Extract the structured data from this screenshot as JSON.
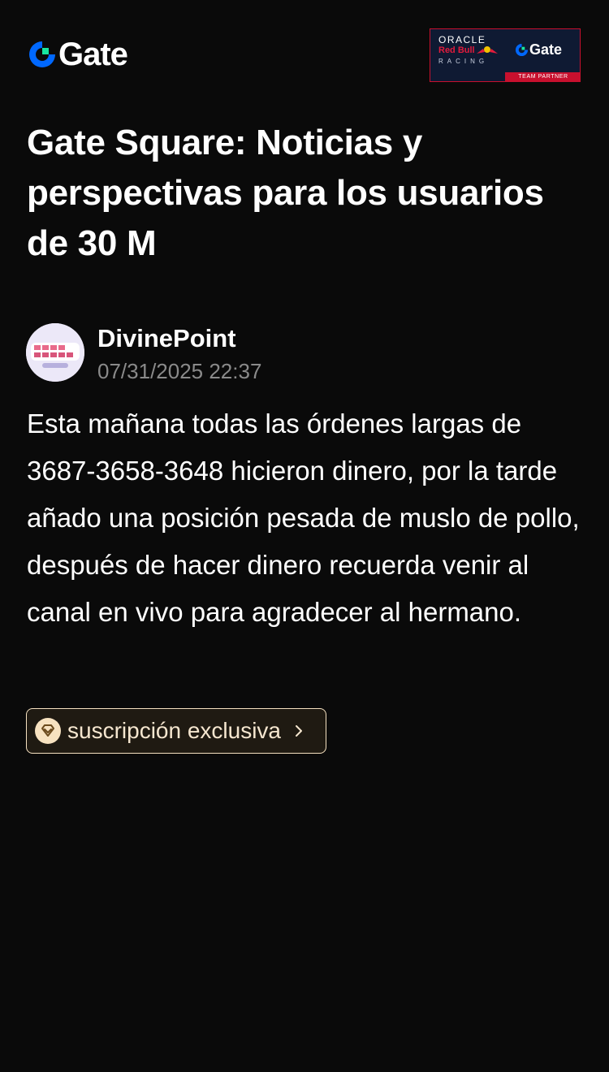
{
  "header": {
    "logo_text": "Gate",
    "badge": {
      "oracle": "ORACLE",
      "redbull": "Red Bull",
      "racing": "RACING",
      "gate": "Gate",
      "strip": "TEAM PARTNER"
    }
  },
  "article": {
    "title": "Gate Square: Noticias y perspectivas para los usuarios de 30 M",
    "author": {
      "name": "DivinePoint",
      "timestamp": "07/31/2025 22:37",
      "avatar_icon": "avatar-image"
    },
    "body": "Esta mañana todas las órdenes largas de 3687-3658-3648 hicieron dinero, por la tarde añado una posición pesada de muslo de pollo, después de hacer dinero recuerda venir al canal en vivo para agradecer al hermano.",
    "subscribe": {
      "label": "suscripción exclusiva",
      "icon": "diamond-icon",
      "chevron": "chevron-right-icon"
    }
  },
  "colors": {
    "background": "#0a0a0a",
    "brand_blue": "#0068ff",
    "brand_green": "#17e6a1",
    "timestamp_gray": "#8a8a8a",
    "subscribe_gold": "#f5e1c1"
  }
}
